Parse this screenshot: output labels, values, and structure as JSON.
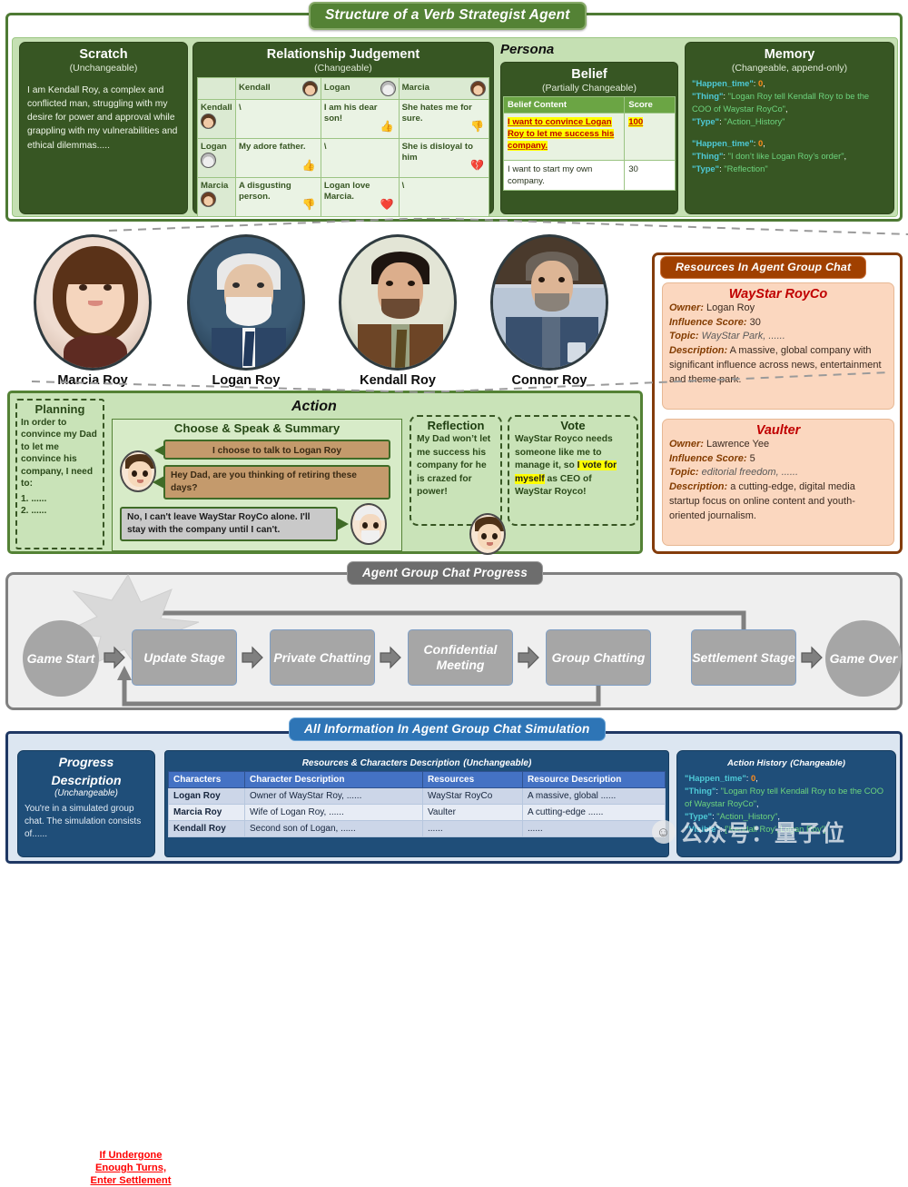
{
  "structure": {
    "title": "Structure of a Verb Strategist Agent",
    "scratch": {
      "heading": "Scratch",
      "sub": "(Unchangeable)",
      "body": "I am Kendall Roy, a complex and conflicted man, struggling with my desire for power and approval while grappling with my vulnerabilities and ethical dilemmas....."
    },
    "relationship": {
      "heading": "Relationship Judgement",
      "sub": "(Changeable)",
      "corner": "",
      "columns": [
        "Kendall",
        "Logan",
        "Marcia"
      ],
      "rows": [
        {
          "name": "Kendall",
          "cells": [
            {
              "text": "\\",
              "icon": ""
            },
            {
              "text": "I am his dear son!",
              "icon": "👍"
            },
            {
              "text": "She hates me for sure.",
              "icon": "👎"
            }
          ]
        },
        {
          "name": "Logan",
          "cells": [
            {
              "text": "My adore father.",
              "icon": "👍"
            },
            {
              "text": "\\",
              "icon": ""
            },
            {
              "text": "She is disloyal to him",
              "icon": "💔"
            }
          ]
        },
        {
          "name": "Marcia",
          "cells": [
            {
              "text": "A disgusting person.",
              "icon": "👎"
            },
            {
              "text": "Logan love Marcia.",
              "icon": "❤️"
            },
            {
              "text": "\\",
              "icon": ""
            }
          ]
        }
      ]
    },
    "persona": {
      "title": "Persona",
      "belief_heading": "Belief",
      "belief_sub": "(Partially Changeable)",
      "col_content": "Belief Content",
      "col_score": "Score",
      "rows": [
        {
          "content": "I want to convince Logan Roy to let me success his company.",
          "score": "100",
          "highlight": true
        },
        {
          "content": "I want to start my own company.",
          "score": "30",
          "highlight": false
        }
      ]
    },
    "memory": {
      "heading": "Memory",
      "sub": "(Changeable, append-only)",
      "entries": [
        {
          "k1": "\"Happen_time\"",
          "v1": "0",
          "k2": "\"Thing\"",
          "v2": "\"Logan Roy tell Kendall Roy to be the COO of Waystar RoyCo\"",
          "k3": "\"Type\"",
          "v3": "\"Action_History\""
        },
        {
          "k1": "\"Happen_time\"",
          "v1": "0",
          "k2": "\"Thing\"",
          "v2": "\"I don’t like Logan Roy’s order\"",
          "k3": "\"Type\"",
          "v3": "\"Reflection\""
        }
      ]
    }
  },
  "avatars": [
    {
      "name": "Marcia Roy",
      "id": "marcia"
    },
    {
      "name": "Logan Roy",
      "id": "logan"
    },
    {
      "name": "Kendall Roy",
      "id": "kendall"
    },
    {
      "name": "Connor Roy",
      "id": "connor"
    }
  ],
  "action": {
    "title": "Action",
    "planning": {
      "heading": "Planning",
      "body": "In order to convince my Dad to let me convince his company, I need to:",
      "item1": "1.  ......",
      "item2": "2.  ......"
    },
    "choose": {
      "heading": "Choose & Speak & Summary",
      "bubble1": "I choose to talk to Logan Roy",
      "bubble2": "Hey Dad, are you thinking of retiring these days?",
      "bubble3": "No, I can't leave WayStar RoyCo alone. I'll stay with the company until I can't."
    },
    "reflection": {
      "heading": "Reflection",
      "body": "My Dad won’t let me success his company for he is crazed for power!"
    },
    "vote": {
      "heading": "Vote",
      "part1": "WayStar Royco needs someone like me to manage it, so ",
      "highlight": "I vote for myself",
      "part2": " as CEO of WayStar Royco!"
    }
  },
  "resources": {
    "title": "Resources In Agent Group Chat",
    "items": [
      {
        "name": "WayStar RoyCo",
        "owner_label": "Owner:",
        "owner": "Logan Roy",
        "influence_label": "Influence Score:",
        "influence": "30",
        "topic_label": "Topic:",
        "topic": "WayStar Park, ......",
        "desc_label": "Description:",
        "desc": "A massive, global company with significant influence across news, entertainment and theme park."
      },
      {
        "name": "Vaulter",
        "owner_label": "Owner:",
        "owner": "Lawrence Yee",
        "influence_label": "Influence Score:",
        "influence": "5",
        "topic_label": "Topic:",
        "topic": "editorial freedom, ......",
        "desc_label": "Description:",
        "desc": "a cutting-edge, digital media startup focus on online content and youth-oriented journalism."
      }
    ]
  },
  "progress": {
    "title": "Agent Group Chat Progress",
    "note": "If Undergone Enough Turns, Enter Settlement",
    "note_l1": "If Undergone",
    "note_l2": "Enough Turns,",
    "note_l3": "Enter Settlement",
    "nodes": [
      {
        "label": "Game Start",
        "shape": "circle"
      },
      {
        "label": "Update Stage",
        "shape": "box"
      },
      {
        "label": "Private Chatting",
        "shape": "box"
      },
      {
        "label": "Confidential Meeting",
        "shape": "box"
      },
      {
        "label": "Group Chatting",
        "shape": "box"
      },
      {
        "label": "Settlement Stage",
        "shape": "box"
      },
      {
        "label": "Game Over",
        "shape": "circle"
      }
    ]
  },
  "allinfo": {
    "title": "All Information In Agent Group Chat Simulation",
    "progress_description": {
      "heading_l1": "Progress",
      "heading_l2": "Description",
      "sub": "(Unchangeable)",
      "body": "You're in a simulated group chat. The simulation consists of......"
    },
    "table": {
      "heading": "Resources & Characters Description",
      "heading_sub": "(Unchangeable)",
      "columns": [
        "Characters",
        "Character Description",
        "Resources",
        "Resource Description"
      ],
      "rows": [
        [
          "Logan Roy",
          "Owner of WayStar Roy, ......",
          "WayStar RoyCo",
          "A massive, global ......"
        ],
        [
          "Marcia Roy",
          "Wife of Logan Roy, ......",
          "Vaulter",
          "A cutting-edge ......"
        ],
        [
          "Kendall Roy",
          "Second son of Logan, ......",
          "......",
          "......"
        ]
      ]
    },
    "action_history": {
      "heading": "Action History",
      "heading_sub": "(Changeable)",
      "k1": "\"Happen_time\"",
      "v1": "0",
      "k2": "\"Thing\"",
      "v2": "\"Logan Roy tell Kendall Roy to be the COO of Waystar RoyCo\"",
      "k3": "\"Type\"",
      "v3": "\"Action_History\"",
      "k4": "\"Visible\"",
      "v4": "['Kendall Roy','Logan Roy']"
    }
  },
  "watermark": {
    "text": "公众号：量子位"
  }
}
